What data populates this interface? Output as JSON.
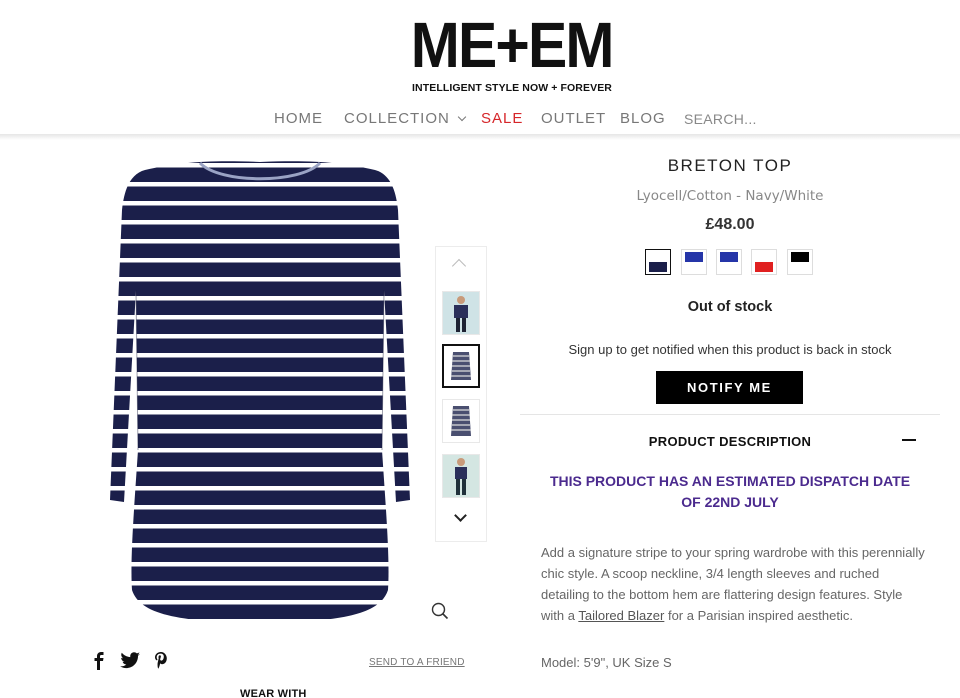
{
  "brand": {
    "logo": "ME+EM",
    "tagline": "INTELLIGENT STYLE NOW + FOREVER"
  },
  "nav": {
    "items": [
      "HOME",
      "COLLECTION",
      "SALE",
      "OUTLET",
      "BLOG"
    ],
    "search_placeholder": "SEARCH..."
  },
  "product": {
    "title": "BRETON TOP",
    "subtitle": "Lyocell/Cotton - Navy/White",
    "price": "£48.00",
    "swatches": [
      {
        "name": "navy-white",
        "color": "#1b1f4a",
        "selected": true
      },
      {
        "name": "royal-blue-1",
        "color": "#2535a8",
        "selected": false
      },
      {
        "name": "royal-blue-2",
        "color": "#2535a8",
        "selected": false
      },
      {
        "name": "red",
        "color": "#e02020",
        "selected": false
      },
      {
        "name": "black",
        "color": "#000000",
        "selected": false
      }
    ],
    "stock_status": "Out of stock",
    "notify_text": "Sign up to get notified when this product is back in stock",
    "notify_button": "NOTIFY ME",
    "description_heading": "PRODUCT DESCRIPTION",
    "dispatch_notice": "THIS PRODUCT HAS AN ESTIMATED DISPATCH DATE OF 22ND JULY",
    "description_part1": "Add a signature stripe to your spring wardrobe with this perennially chic style. A scoop neckline, 3/4 length sleeves and ruched detailing to the bottom hem are flattering design features. Style with a ",
    "description_link": "Tailored Blazer",
    "description_part2": " for a Parisian inspired aesthetic.",
    "model_info": "Model: 5'9\", UK Size S"
  },
  "gallery": {
    "thumbnail_count": 4,
    "active_index": 1
  },
  "share": {
    "send_to_friend": "SEND TO A FRIEND"
  },
  "wear_with": "WEAR WITH",
  "colors": {
    "accent_red": "#d6262a",
    "dispatch_purple": "#4b2a8e",
    "navy": "#1b1f4a"
  }
}
